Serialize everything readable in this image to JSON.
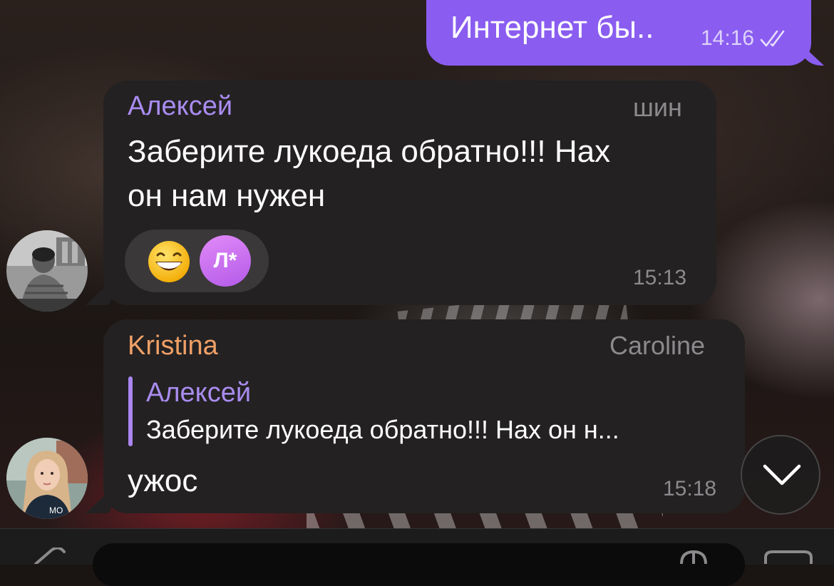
{
  "outgoing": {
    "text": "Интернет бы..",
    "time": "14:16",
    "status_icon": "double-check-icon"
  },
  "messages": [
    {
      "sender": "Алексей",
      "role": "шин",
      "text_line1": "Заберите лукоеда обратно!!! Нах",
      "text_line2": "он нам нужен",
      "time": "15:13",
      "sender_color": "#a98cf0",
      "reactions": {
        "emoji": "grinning-face",
        "reactor_initials": "Л*"
      }
    },
    {
      "sender": "Kristina",
      "role": "Caroline",
      "reply": {
        "sender": "Алексей",
        "text": "Заберите лукоеда обратно!!! Нах он н..."
      },
      "text": "ужос",
      "time": "15:18",
      "sender_color": "#f0a066"
    }
  ],
  "colors": {
    "outgoing_bubble": "#8a5df0",
    "incoming_bubble": "#232122",
    "reply_accent": "#a986f0"
  },
  "icons": {
    "scroll_down": "chevron-down-icon",
    "attach": "paperclip-icon",
    "sticker": "sticker-icon",
    "camera": "camera-icon"
  }
}
